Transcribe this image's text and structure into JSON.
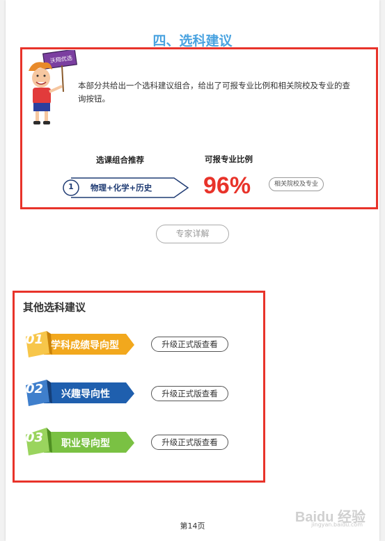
{
  "title": "四、选科建议",
  "intro": "本部分共给出一个选科建议组合，给出了可报专业比例和相关院校及专业的查询按钮。",
  "sign_text": "沃翔优选",
  "combo": {
    "header": "选课组合推荐",
    "number": "1",
    "subjects": "物理+化学+历史"
  },
  "ratio": {
    "header": "可报专业比例",
    "value": "96%",
    "link_label": "相关院校及专业"
  },
  "expert_button": "专家详解",
  "others": {
    "title": "其他选科建议",
    "items": [
      {
        "num": "01",
        "label": "学科成绩导向型",
        "color": "#f2a81d",
        "dark": "#c9820a",
        "button": "升级正式版查看"
      },
      {
        "num": "02",
        "label": "兴趣导向性",
        "color": "#1f5fae",
        "dark": "#153f78",
        "button": "升级正式版查看"
      },
      {
        "num": "03",
        "label": "职业导向型",
        "color": "#7ac143",
        "dark": "#4f8f22",
        "button": "升级正式版查看"
      }
    ]
  },
  "footer": "第14页",
  "watermark": {
    "brand": "Baidu 经验",
    "url": "jingyan.baidu.com"
  },
  "colors": {
    "accent": "#4aa3e0",
    "highlight": "#e8332a",
    "navy": "#1f3b73"
  }
}
